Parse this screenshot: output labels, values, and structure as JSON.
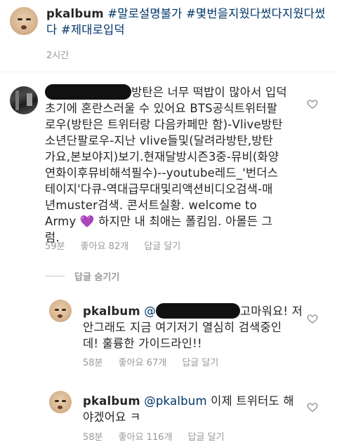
{
  "post": {
    "username": "pkalbum",
    "caption": "#말로설명불가 #몇번을지웠다썼다지웠다썼다 #제대로입덕",
    "time": "2시간"
  },
  "comment": {
    "text_line1": "방탄은 너무 떡밥이 많아서 입덕",
    "text_rest": [
      "초기에 혼란스러울 수 있어요  BTS공식트위터팔",
      "로우(방탄은 트위터랑 다음카페만 함)-Vlive방탄",
      "소년단팔로우-지난 vlive들및(달려라방탄,방탄",
      "가요,본보야지)보기.현재달방시즌3중-뮤비(화양",
      "연화이후뮤비해석필수)--youtube레드_'번더스",
      "테이지'다큐-역대급무대및리액션비디오검색-매",
      "년muster검색. 콘서트실황. welcome to"
    ],
    "text_army": "Army",
    "heart_emoji": "💜",
    "text_after_emoji": "  하지만 내 최애는 폴킴임. 아몰든 그",
    "text_last": "럼.",
    "time": "59분",
    "likes": "좋아요 82개",
    "reply": "답글 달기"
  },
  "hide_replies": "답글 숨기기",
  "replies": [
    {
      "username": "pkalbum",
      "mention": "@",
      "text_line1": "고마워요! 저",
      "text_rest": [
        "안그래도 지금 여기저기 열심히 검색중인",
        "데! 훌륭한 가이드라인!!"
      ],
      "time": "58분",
      "likes": "좋아요 67개",
      "reply": "답글 달기"
    },
    {
      "username": "pkalbum",
      "mention": "@pkalbum",
      "text_line1": " 이제 트위터도 해",
      "text_rest": [
        "야겠어요 ㅋ"
      ],
      "time": "58분",
      "likes": "좋아요 116개",
      "reply": "답글 달기"
    }
  ],
  "colors": {
    "hashtag": "#003569",
    "meta": "#999999",
    "text": "#262626"
  },
  "icons": [
    "heart-outline-icon"
  ]
}
